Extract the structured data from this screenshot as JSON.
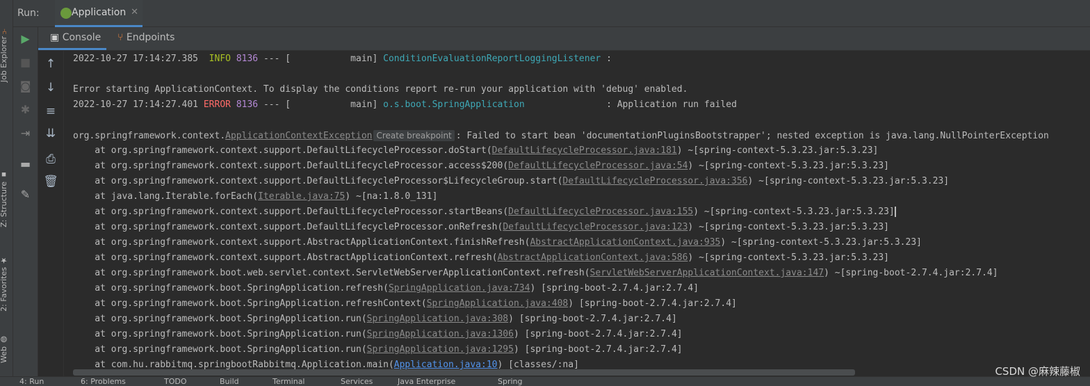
{
  "leftbar": {
    "job_explorer": "Job Explorer",
    "structure": "Z: Structure",
    "favorites": "2: Favorites",
    "web": "Web"
  },
  "runbar": {
    "label": "Run:",
    "tab_label": "Application"
  },
  "subtabs": {
    "console": "Console",
    "endpoints": "Endpoints"
  },
  "tooltip": "Create breakpoint",
  "log": {
    "l1": {
      "ts": "2022-10-27 17:14:27.385",
      "level": "INFO",
      "pid": "8136",
      "sep": "--- [           main]",
      "logger": "ConditionEvaluationReportLoggingListener",
      "msg": ":"
    },
    "l2": "Error starting ApplicationContext. To display the conditions report re-run your application with 'debug' enabled.",
    "l3": {
      "ts": "2022-10-27 17:14:27.401",
      "level": "ERROR",
      "pid": "8136",
      "sep": "--- [           main]",
      "logger": "o.s.boot.SpringApplication",
      "pad": "               ",
      "msg": ": Application run failed"
    },
    "exc_prefix": "org.springframework.context.",
    "exc_class": "ApplicationContextException",
    "exc_msg": ": Failed to start bean 'documentationPluginsBootstrapper'; nested exception is java.lang.NullPointerException",
    "stack": [
      {
        "call": "    at org.springframework.context.support.DefaultLifecycleProcessor.doStart(",
        "src": "DefaultLifecycleProcessor.java:181",
        "tail": ") ~[spring-context-5.3.23.jar:5.3.23]"
      },
      {
        "call": "    at org.springframework.context.support.DefaultLifecycleProcessor.access$200(",
        "src": "DefaultLifecycleProcessor.java:54",
        "tail": ") ~[spring-context-5.3.23.jar:5.3.23]"
      },
      {
        "call": "    at org.springframework.context.support.DefaultLifecycleProcessor$LifecycleGroup.start(",
        "src": "DefaultLifecycleProcessor.java:356",
        "tail": ") ~[spring-context-5.3.23.jar:5.3.23]"
      },
      {
        "call": "    at java.lang.Iterable.forEach(",
        "src": "Iterable.java:75",
        "tail": ") ~[na:1.8.0_131]"
      },
      {
        "call": "    at org.springframework.context.support.DefaultLifecycleProcessor.startBeans(",
        "src": "DefaultLifecycleProcessor.java:155",
        "tail": ") ~[spring-context-5.3.23.jar:5.3.23]"
      },
      {
        "call": "    at org.springframework.context.support.DefaultLifecycleProcessor.onRefresh(",
        "src": "DefaultLifecycleProcessor.java:123",
        "tail": ") ~[spring-context-5.3.23.jar:5.3.23]"
      },
      {
        "call": "    at org.springframework.context.support.AbstractApplicationContext.finishRefresh(",
        "src": "AbstractApplicationContext.java:935",
        "tail": ") ~[spring-context-5.3.23.jar:5.3.23]"
      },
      {
        "call": "    at org.springframework.context.support.AbstractApplicationContext.refresh(",
        "src": "AbstractApplicationContext.java:586",
        "tail": ") ~[spring-context-5.3.23.jar:5.3.23]"
      },
      {
        "call": "    at org.springframework.boot.web.servlet.context.ServletWebServerApplicationContext.refresh(",
        "src": "ServletWebServerApplicationContext.java:147",
        "tail": ") ~[spring-boot-2.7.4.jar:2.7.4]"
      },
      {
        "call": "    at org.springframework.boot.SpringApplication.refresh(",
        "src": "SpringApplication.java:734",
        "tail": ") [spring-boot-2.7.4.jar:2.7.4]"
      },
      {
        "call": "    at org.springframework.boot.SpringApplication.refreshContext(",
        "src": "SpringApplication.java:408",
        "tail": ") [spring-boot-2.7.4.jar:2.7.4]"
      },
      {
        "call": "    at org.springframework.boot.SpringApplication.run(",
        "src": "SpringApplication.java:308",
        "tail": ") [spring-boot-2.7.4.jar:2.7.4]"
      },
      {
        "call": "    at org.springframework.boot.SpringApplication.run(",
        "src": "SpringApplication.java:1306",
        "tail": ") [spring-boot-2.7.4.jar:2.7.4]"
      },
      {
        "call": "    at org.springframework.boot.SpringApplication.run(",
        "src": "SpringApplication.java:1295",
        "tail": ") [spring-boot-2.7.4.jar:2.7.4]"
      },
      {
        "call": "    at com.hu.rabbitmq.springbootRabbitmq.Application.main(",
        "src": "Application.java:10",
        "tail": ") [classes/:na]"
      }
    ]
  },
  "bottom_tabs": [
    "4: Run",
    "6: Problems",
    "TODO",
    "Build",
    "Terminal",
    "Services",
    "Java Enterprise",
    "Spring"
  ],
  "watermark": "CSDN @麻辣藤椒"
}
